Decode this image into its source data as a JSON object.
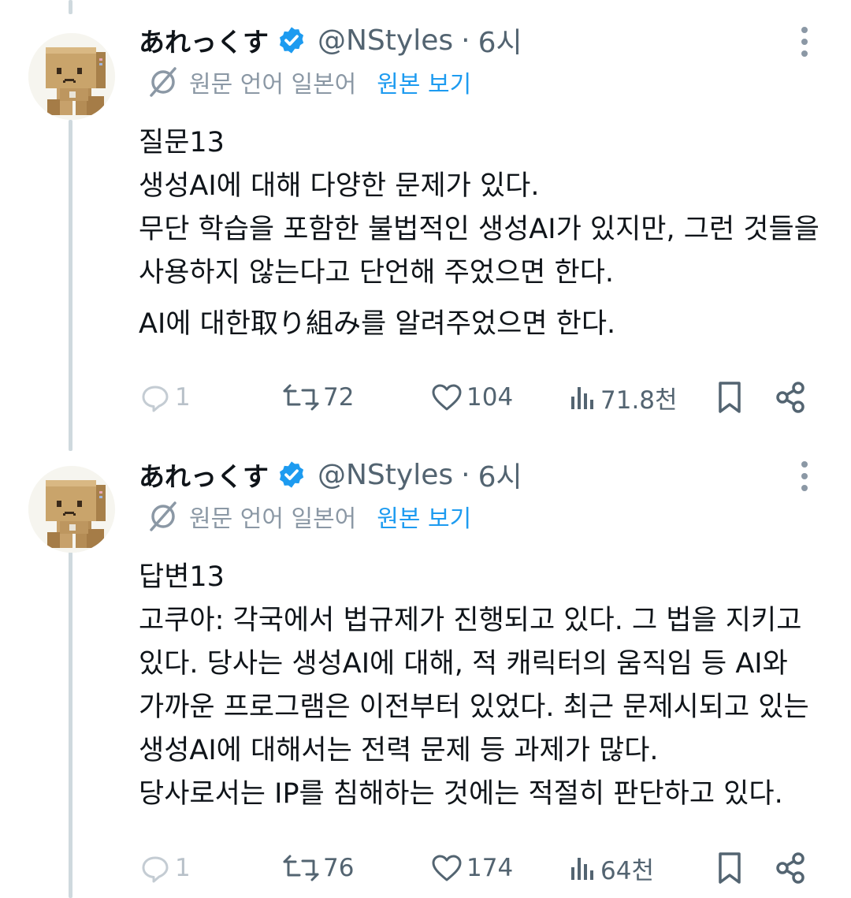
{
  "tweets": [
    {
      "author_name": "あれっくす",
      "handle": "@NStyles",
      "separator": "·",
      "time": "6시",
      "translation": {
        "label": "원문 언어 일본어",
        "show_original": "원본 보기"
      },
      "lines": [
        "질문13",
        "생성AI에 대해 다양한 문제가 있다.",
        "무단 학습을 포함한 불법적인 생성AI가 있지만, 그런 것들을",
        "사용하지 않는다고 단언해 주었으면 한다.",
        "AI에 대한取り組み를 알려주었으면 한다."
      ],
      "stats": {
        "replies": "1",
        "reposts": "72",
        "likes": "104",
        "views": "71.8천"
      }
    },
    {
      "author_name": "あれっくす",
      "handle": "@NStyles",
      "separator": "·",
      "time": "6시",
      "translation": {
        "label": "원문 언어 일본어",
        "show_original": "원본 보기"
      },
      "lines": [
        "답변13",
        "고쿠아: 각국에서 법규제가 진행되고 있다. 그 법을 지키고",
        "있다. 당사는 생성AI에 대해, 적 캐릭터의 움직임 등 AI와",
        "가까운 프로그램은 이전부터 있었다. 최근 문제시되고 있는",
        "생성AI에 대해서는 전력 문제 등 과제가 많다.",
        "당사로서는 IP를 침해하는 것에는 적절히 판단하고 있다."
      ],
      "stats": {
        "replies": "1",
        "reposts": "76",
        "likes": "174",
        "views": "64천"
      }
    }
  ],
  "icons": {
    "verified": "verified-badge-icon",
    "more": "more-options-icon",
    "translate": "translate-icon",
    "reply": "reply-icon",
    "repost": "repost-icon",
    "like": "like-icon",
    "views": "views-icon",
    "bookmark": "bookmark-icon",
    "share": "share-icon"
  },
  "colors": {
    "link_blue": "#1d9bf0",
    "secondary_text": "#536471",
    "thread_line": "#cfd9de"
  }
}
